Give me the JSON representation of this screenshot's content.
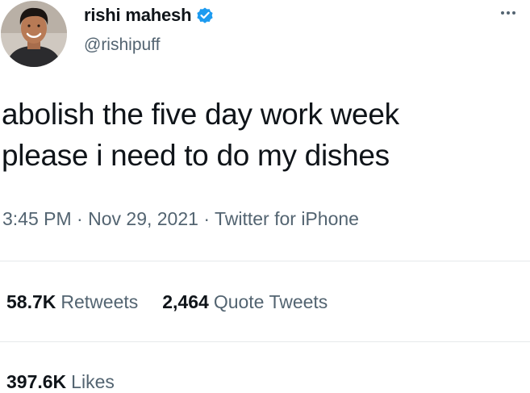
{
  "tweet": {
    "author": {
      "display_name": "rishi mahesh",
      "handle": "@rishipuff",
      "verified": true,
      "verified_color": "#1d9bf0"
    },
    "more_icon": "more-dots-icon",
    "text_lines": [
      "abolish the five day work week",
      "please i need to do my dishes"
    ],
    "meta": {
      "time": "3:45 PM",
      "separator": "·",
      "date": "Nov 29, 2021",
      "source": "Twitter for iPhone"
    },
    "stats": {
      "retweets": {
        "count": "58.7K",
        "label": "Retweets"
      },
      "quote_tweets": {
        "count": "2,464",
        "label": "Quote Tweets"
      },
      "likes": {
        "count": "397.6K",
        "label": "Likes"
      }
    }
  },
  "colors": {
    "text_primary": "#0f1419",
    "text_secondary": "#536471",
    "divider": "#e6e9eb"
  }
}
